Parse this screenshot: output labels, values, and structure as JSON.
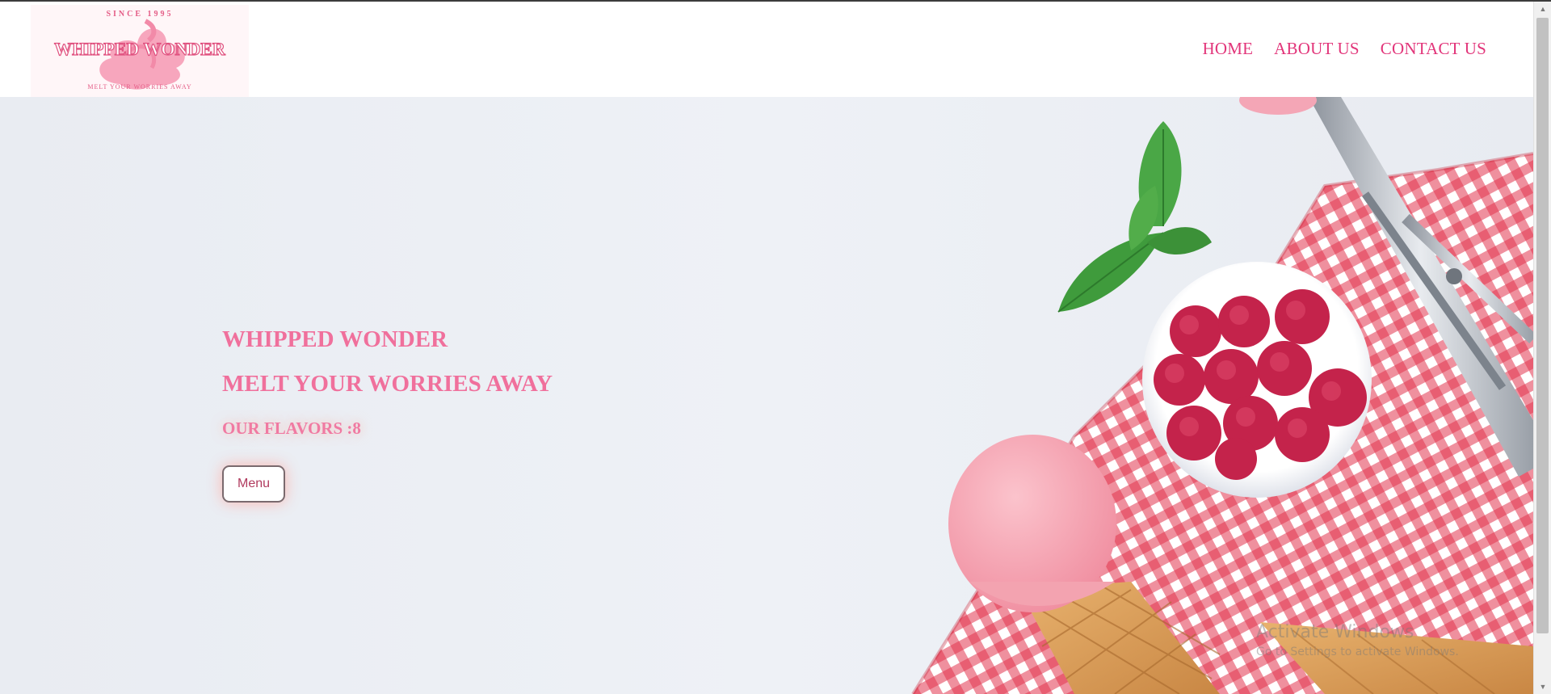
{
  "brand": {
    "logo_top_text": "SINCE 1995",
    "logo_name": "WHIPPED WONDER",
    "logo_bottom_text": "MELT YOUR WORRIES AWAY",
    "accent_color": "#e2357a"
  },
  "nav": {
    "items": [
      {
        "label": "HOME"
      },
      {
        "label": "ABOUT US"
      },
      {
        "label": "CONTACT US"
      }
    ]
  },
  "hero": {
    "title": "WHIPPED WONDER",
    "tagline": "MELT YOUR WORRIES AWAY",
    "flavors": "OUR FLAVORS :8",
    "menu_button": "Menu",
    "image_icon": "ice-cream-raspberry-photo"
  },
  "watermark": {
    "line1": "Activate Windows",
    "line2": "Go to Settings to activate Windows."
  },
  "scrollbar": {
    "up_icon": "▲",
    "down_icon": "▼"
  }
}
